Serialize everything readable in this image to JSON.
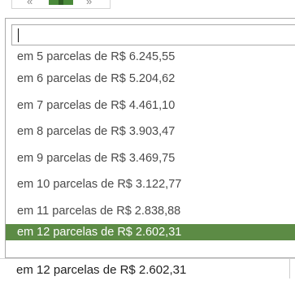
{
  "pager": {
    "prev_symbol": "«",
    "next_symbol": "»"
  },
  "search": {
    "value": "",
    "placeholder": ""
  },
  "options": [
    {
      "label": "em 5 parcelas de R$ 6.245,55",
      "highlighted": false
    },
    {
      "label": "em 6 parcelas de R$ 5.204,62",
      "highlighted": false
    },
    {
      "label": "em 7 parcelas de R$ 4.461,10",
      "highlighted": false
    },
    {
      "label": "em 8 parcelas de R$ 3.903,47",
      "highlighted": false
    },
    {
      "label": "em 9 parcelas de R$ 3.469,75",
      "highlighted": false
    },
    {
      "label": "em 10 parcelas de R$ 3.122,77",
      "highlighted": false
    },
    {
      "label": "em 11 parcelas de R$ 2.838,88",
      "highlighted": false
    },
    {
      "label": "em 12 parcelas de R$ 2.602,31",
      "highlighted": true
    }
  ],
  "selected": {
    "value": "em 12 parcelas de R$ 2.602,31"
  },
  "colors": {
    "highlight": "#5c8b45",
    "pager_active": "#4a8a3a"
  }
}
